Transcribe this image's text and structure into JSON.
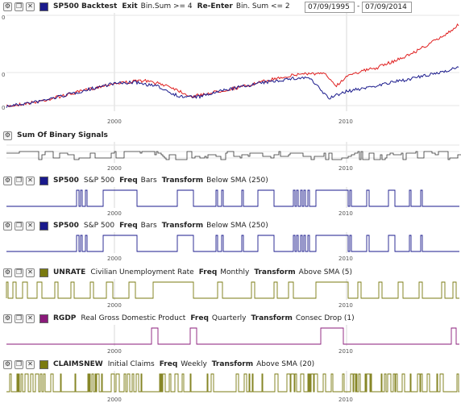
{
  "backtest": {
    "symbol": "SP500 Backtest",
    "exit_label": "Exit",
    "exit_rule": "Bin.Sum >= 4",
    "reenter_label": "Re-Enter",
    "reenter_rule": "Bin. Sum <= 2",
    "start_date": "07/09/1995",
    "date_separator": "-",
    "end_date": "07/09/2014",
    "swatch_color": "#1a1a8c"
  },
  "binary_sum": {
    "title": "Sum Of Binary Signals"
  },
  "signals": [
    {
      "symbol": "SP500",
      "name": "S&P 500",
      "freq_label": "Freq",
      "freq": "Bars",
      "transform_label": "Transform",
      "transform": "Below SMA (250)",
      "color": "#1a1a8c"
    },
    {
      "symbol": "SP500",
      "name": "S&P 500",
      "freq_label": "Freq",
      "freq": "Bars",
      "transform_label": "Transform",
      "transform": "Below SMA (250)",
      "color": "#1a1a8c"
    },
    {
      "symbol": "UNRATE",
      "name": "Civilian Unemployment Rate",
      "freq_label": "Freq",
      "freq": "Monthly",
      "transform_label": "Transform",
      "transform": "Above SMA (5)",
      "color": "#7a7a10"
    },
    {
      "symbol": "RGDP",
      "name": "Real Gross Domestic Product",
      "freq_label": "Freq",
      "freq": "Quarterly",
      "transform_label": "Transform",
      "transform": "Consec Drop (1)",
      "color": "#8a1a7a"
    },
    {
      "symbol": "CLAIMSNEW",
      "name": "Initial Claims",
      "freq_label": "Freq",
      "freq": "Weekly",
      "transform_label": "Transform",
      "transform": "Above SMA (20)",
      "color": "#7a7a10"
    }
  ],
  "axis": {
    "x_ticks": [
      "2000",
      "2010"
    ],
    "y_ticks_main": [
      "0",
      "0",
      "0"
    ]
  },
  "icons": {
    "settings": "gear-icon",
    "copy": "copy-icon",
    "close": "close-icon"
  }
}
